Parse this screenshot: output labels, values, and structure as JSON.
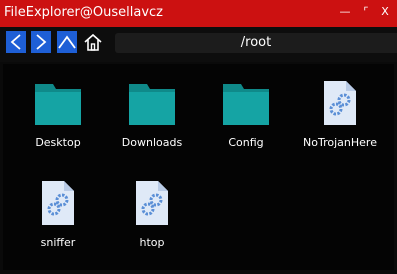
{
  "window": {
    "title": "FileExplorer@Ousellavcz",
    "minimize_glyph": "—",
    "maximize_glyph": "⌜",
    "close_glyph": "X"
  },
  "toolbar": {
    "path": "/root",
    "back_icon": "chevron-left-icon",
    "forward_icon": "chevron-right-icon",
    "up_icon": "chevron-up-icon",
    "home_icon": "home-icon",
    "button_color": "#1e5fd6"
  },
  "items": [
    {
      "name": "Desktop",
      "kind": "folder"
    },
    {
      "name": "Downloads",
      "kind": "folder"
    },
    {
      "name": "Config",
      "kind": "folder"
    },
    {
      "name": "NoTrojanHere",
      "kind": "file"
    },
    {
      "name": "sniffer",
      "kind": "file"
    },
    {
      "name": "htop",
      "kind": "file"
    }
  ],
  "colors": {
    "titlebar": "#cc1111",
    "folder": "#15a4a4",
    "folder_tab": "#0f8a8a",
    "file": "#dfe9f7",
    "file_gear": "#5b8fd6"
  }
}
